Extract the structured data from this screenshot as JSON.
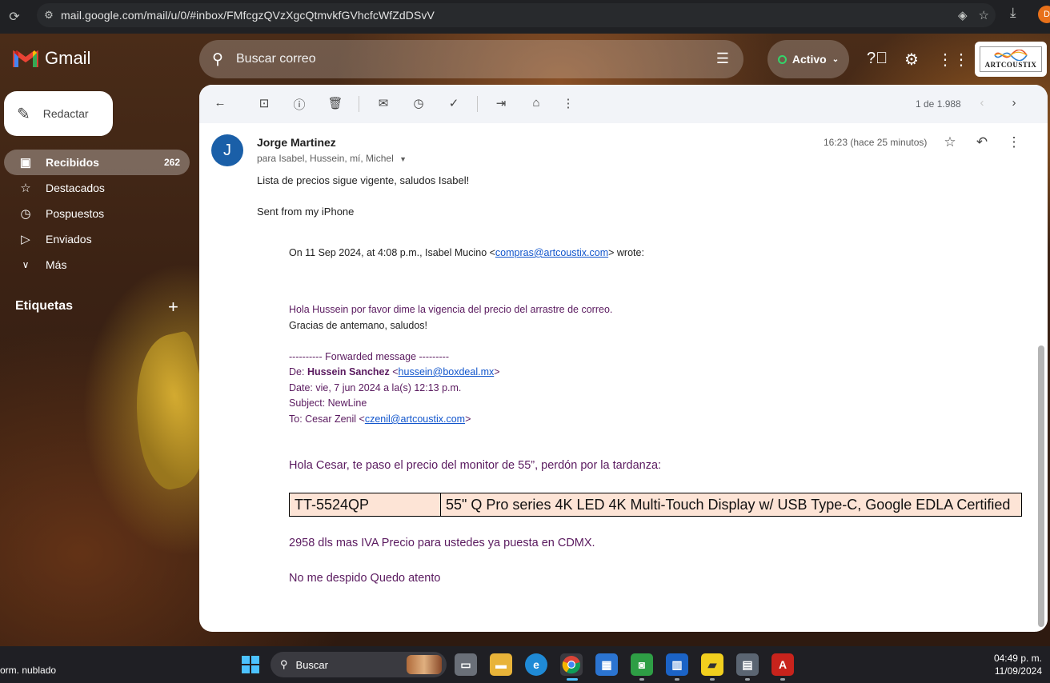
{
  "browser": {
    "url": "mail.google.com/mail/u/0/#inbox/FMfcgzQVzXgcQtmvkfGVhcfcWfZdDSvV",
    "profile_initial": "D"
  },
  "header": {
    "app_name": "Gmail",
    "search_placeholder": "Buscar correo",
    "status_label": "Activo",
    "brand_name": "ARTCOUSTIX"
  },
  "sidebar": {
    "compose_label": "Redactar",
    "items": [
      {
        "label": "Recibidos",
        "count": "262"
      },
      {
        "label": "Destacados"
      },
      {
        "label": "Pospuestos"
      },
      {
        "label": "Enviados"
      },
      {
        "label": "Más"
      }
    ],
    "labels_title": "Etiquetas"
  },
  "toolbar": {
    "pager": "1 de 1.988"
  },
  "email": {
    "avatar_initial": "J",
    "sender": "Jorge Martinez",
    "recipients": "para Isabel, Hussein, mí, Michel",
    "time": "16:23 (hace 25 minutos)",
    "body_line1": "Lista de precios sigue vigente, saludos Isabel!",
    "body_line2": "Sent from my iPhone",
    "quote_intro_pre": "On 11 Sep 2024, at 4:08 p.m., Isabel Mucino <",
    "quote_intro_link": "compras@artcoustix.com",
    "quote_intro_post": "> wrote:",
    "q_line1": "Hola Hussein por favor dime la vigencia del precio del arrastre de correo.",
    "q_line2": "Gracias de antemano, saludos!",
    "fwd_header": "---------- Forwarded message ---------",
    "fwd_from_label": "De: ",
    "fwd_from_name": "Hussein Sanchez",
    "fwd_from_pre": " <",
    "fwd_from_link": "hussein@boxdeal.mx",
    "fwd_from_post": ">",
    "fwd_date": "Date: vie, 7 jun 2024 a la(s) 12:13 p.m.",
    "fwd_subject": "Subject: NewLine",
    "fwd_to_pre": "To: Cesar Zenil <",
    "fwd_to_link": "czenil@artcoustix.com",
    "fwd_to_post": ">",
    "greeting": "Hola Cesar, te paso el precio del monitor de 55”, perdón por la tardanza:",
    "table": {
      "model": "TT-5524QP",
      "description": "55\" Q Pro series 4K LED 4K Multi-Touch Display w/ USB Type-C, Google EDLA Certified"
    },
    "price_line": "2958 dls mas IVA Precio para ustedes ya puesta en CDMX.",
    "closing": "No me despido Quedo atento"
  },
  "taskbar": {
    "weather": "orm. nublado",
    "search_label": "Buscar",
    "time": "04:49 p. m.",
    "date": "11/09/2024"
  }
}
